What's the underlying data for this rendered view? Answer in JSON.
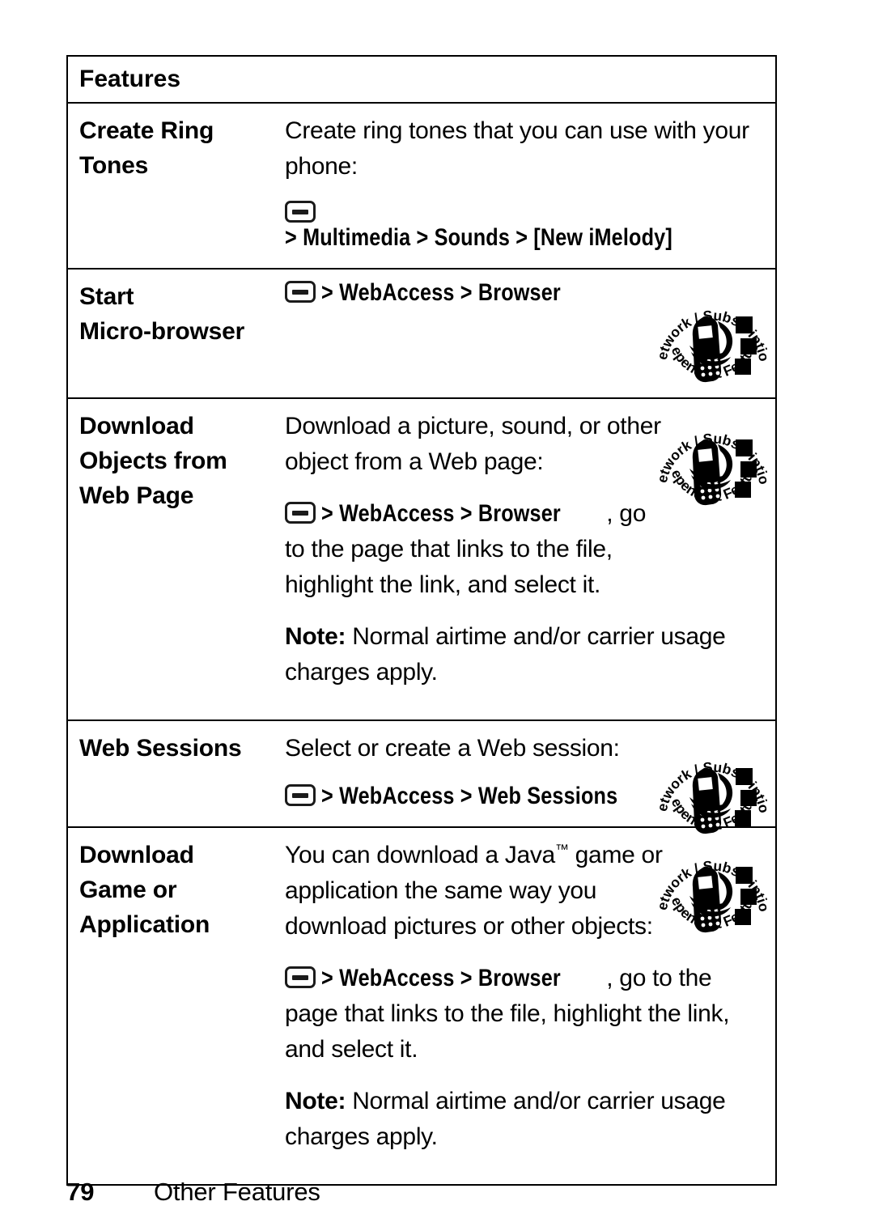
{
  "table": {
    "header": {
      "label": "Features"
    },
    "rows": [
      {
        "label": "Create Ring\nTones",
        "label_lines": [
          "Create Ring",
          "Tones"
        ],
        "paragraphs": [
          {
            "kind": "text",
            "text": "Create ring tones that you can use with your phone:"
          }
        ],
        "path": {
          "icon": "menu-key-icon",
          "segments": [
            "Multimedia",
            "Sounds",
            "[New iMelody]"
          ],
          "separator": ">",
          "trailing": ""
        },
        "badge": false
      },
      {
        "label_lines": [
          "Start",
          "Micro-browser"
        ],
        "paragraphs": [],
        "path": {
          "icon": "menu-key-icon",
          "segments": [
            "WebAccess",
            "Browser"
          ],
          "separator": ">",
          "trailing": ""
        },
        "badge": true
      },
      {
        "label_lines": [
          "Download",
          "Objects from",
          "Web Page"
        ],
        "paragraphs": [
          {
            "kind": "text",
            "text": "Download a picture, sound, or other object from a Web page:"
          }
        ],
        "path": {
          "icon": "menu-key-icon",
          "segments": [
            "WebAccess",
            "Browser"
          ],
          "separator": ">",
          "trailing": ", go to the page that links to the file, highlight the link, and select it."
        },
        "note": {
          "label": "Note:",
          "text": " Normal airtime and/or carrier usage charges apply."
        },
        "badge": true
      },
      {
        "label_lines": [
          "Web Sessions"
        ],
        "paragraphs": [
          {
            "kind": "text",
            "text": "Select or create a Web session:"
          }
        ],
        "path": {
          "icon": "menu-key-icon",
          "segments": [
            "WebAccess",
            "Web Sessions"
          ],
          "separator": ">",
          "trailing": ""
        },
        "badge": true
      },
      {
        "label_lines": [
          "Download",
          "Game or",
          "Application"
        ],
        "paragraphs": [
          {
            "kind": "text_tm",
            "before": "You can download a Java",
            "tm": "™",
            "after": " game or application the same way you download pictures or other objects:"
          }
        ],
        "path": {
          "icon": "menu-key-icon",
          "segments": [
            "WebAccess",
            "Browser"
          ],
          "separator": ">",
          "trailing": ", go to the page that links to the file, highlight the link, and select it."
        },
        "note": {
          "label": "Note:",
          "text": " Normal airtime and/or carrier usage charges apply."
        },
        "badge": true
      }
    ]
  },
  "badge": {
    "name": "network-subscription-dependent-feature-icon",
    "top_text": "Network / Subscription",
    "bottom_text": "Dependent Feature"
  },
  "footer": {
    "page_number": "79",
    "section_title": "Other Features"
  },
  "colors": {
    "ink": "#000000",
    "paper": "#ffffff",
    "rule": "#000000"
  }
}
